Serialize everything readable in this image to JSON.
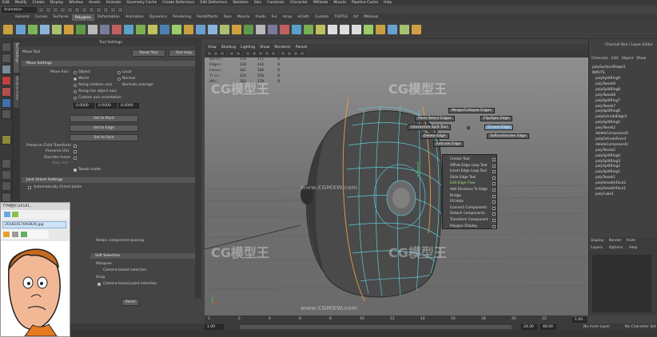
{
  "menubar": [
    "Edit",
    "Modify",
    "Create",
    "Display",
    "Window",
    "Assets",
    "Animate",
    "Geometry Cache",
    "Create Deformers",
    "Edit Deformers",
    "Skeleton",
    "Skin",
    "Constrain",
    "Character",
    "MGtools",
    "Muscle",
    "Pipeline Cache",
    "Help"
  ],
  "status": {
    "mode": "Animation"
  },
  "shelf_tabs": [
    {
      "label": "General",
      "active": false
    },
    {
      "label": "Curves",
      "active": false
    },
    {
      "label": "Surfaces",
      "active": false
    },
    {
      "label": "Polygons",
      "active": true
    },
    {
      "label": "Deformation",
      "active": false
    },
    {
      "label": "Animation",
      "active": false
    },
    {
      "label": "Dynamics",
      "active": false
    },
    {
      "label": "Rendering",
      "active": false
    },
    {
      "label": "PaintEffects",
      "active": false
    },
    {
      "label": "Toon",
      "active": false
    },
    {
      "label": "Muscle",
      "active": false
    },
    {
      "label": "Fluids",
      "active": false
    },
    {
      "label": "Fur",
      "active": false
    },
    {
      "label": "mray",
      "active": false
    },
    {
      "label": "nCloth",
      "active": false
    },
    {
      "label": "Custom",
      "active": false
    },
    {
      "label": "TURTLE",
      "active": false
    },
    {
      "label": "fxf",
      "active": false
    },
    {
      "label": "MGtools",
      "active": false
    }
  ],
  "tool_settings": {
    "window_title": "Tool Settings",
    "tool_name": "Move Tool",
    "reset_tool": "Reset Tool",
    "tool_help": "Tool Help",
    "move_settings": "Move Settings",
    "move_axis_label": "Move Axis",
    "move_axis_options": [
      "Object",
      "Local",
      "World",
      "Normal"
    ],
    "along_rotation_axis": "Along rotation axis",
    "normals_average": "Normals average",
    "along_live_object_axis": "Along live object axis",
    "custom_axis_orientation": "Custom axis orientation",
    "axis_values": [
      "0.0000",
      "0.0000",
      "0.0000"
    ],
    "set_to_point": "Set to Point",
    "set_to_edge": "Set to Edge",
    "set_to_face": "Set to Face",
    "preserve_child_transform": "Preserve Child Transform",
    "preserve_uvs": "Preserve UVs",
    "discrete_move": "Discrete move",
    "step_size": "Step size",
    "tweak_mode": "Tweak mode",
    "joint_orient_settings": "Joint Orient Settings",
    "auto_orient_joints": "Automatically Orient Joints",
    "retain_component_spacing": "Retain component spacing",
    "soft_selection": "Soft Selection",
    "marquee": "Marquee",
    "camera_based_selection": "Camera based selection",
    "drag": "Drag",
    "camera_based_paint_selection": "Camera based paint selection",
    "reset_button": "Reset"
  },
  "viewport": {
    "menu": [
      "View",
      "Shading",
      "Lighting",
      "Show",
      "Renderer",
      "Panels"
    ],
    "hud": [
      {
        "label": "Verts:",
        "v1": "176",
        "v2": "171",
        "v3": "0"
      },
      {
        "label": "Edges:",
        "v1": "338",
        "v2": "334",
        "v3": "0"
      },
      {
        "label": "Faces:",
        "v1": "162",
        "v2": "160",
        "v3": "0"
      },
      {
        "label": "Tris:",
        "v1": "324",
        "v2": "320",
        "v3": "0"
      },
      {
        "label": "UVs:",
        "v1": "183",
        "v2": "179",
        "v3": "0"
      }
    ],
    "marking_menu": {
      "merge_collapse": "Merge/Collapse Edges",
      "paint_select": "Paint Select Edges",
      "flip_spin": "Flip/Spin Edge",
      "split_tool": "Interactive Split Tool",
      "crease_edge": "Crease Edge",
      "delete_edge": "Delete Edge",
      "soften_harden": "Soften/Harden Edge",
      "extrude_edge": "Extrude Edge"
    },
    "submenu": [
      {
        "label": "Crease Tool",
        "on": false
      },
      {
        "label": "Offset Edge Loop Tool",
        "on": false
      },
      {
        "label": "Insert Edge Loop Tool",
        "on": false
      },
      {
        "label": "Slide Edge Tool",
        "on": false
      },
      {
        "label": "Edit Edge Flow",
        "on": true
      },
      {
        "label": "Add Divisions To Edge",
        "on": false
      },
      {
        "label": "Bridge",
        "on": false
      },
      {
        "label": "Fill Hole",
        "on": false
      },
      {
        "label": "Connect Components",
        "on": false
      },
      {
        "label": "Detach Components",
        "on": false
      },
      {
        "label": "Transform Component",
        "on": false
      },
      {
        "label": "Polygon Display",
        "on": false
      }
    ]
  },
  "watermark": "CG模型王",
  "watermark_url": "www.CGMXW.com",
  "channel_box": {
    "title": "Channel Box / Layer Editor",
    "menu": [
      "Channels",
      "Edit",
      "Object",
      "Show"
    ],
    "object": "polySurfaceShape1",
    "inputs_label": "INPUTS",
    "inputs": [
      "polySplitRing9",
      "polyTweak9",
      "polySplitRing8",
      "polyTweak8",
      "polySplitRing7",
      "polyTweak7",
      "polySplitRing6",
      "polyExtrudeEdge1",
      "polySplitRing5",
      "polyTweak2",
      "deleteComponent2",
      "polyExtrudeFace3",
      "deleteComponent1",
      "polyTweak2",
      "polySplitRing4",
      "polySplitRing3",
      "polySplitRing2",
      "polySplitRing1",
      "polyTweak1",
      "polySmoothFace2",
      "polySmoothFace1",
      "polyCube1"
    ],
    "layer_tabs": [
      "Display",
      "Render",
      "Anim"
    ],
    "layer_menu": [
      "Layers",
      "Options",
      "Help"
    ]
  },
  "timeline": {
    "ticks": [
      "1",
      "2",
      "4",
      "6",
      "8",
      "10",
      "12",
      "14",
      "16",
      "18",
      "20",
      "22",
      "24"
    ]
  },
  "range": {
    "start": "1.00",
    "current": "1.00",
    "end": "24.00",
    "end2": "48.00",
    "anim_layer": "No Anim Layer",
    "char_set": "No Character Set"
  },
  "file_window": {
    "path": "TTM相片\\20181...",
    "filename": "20181017093926.jpg"
  }
}
